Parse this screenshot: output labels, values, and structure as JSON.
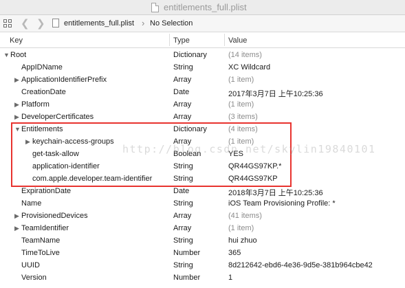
{
  "window": {
    "title": "entitlements_full.plist"
  },
  "jumpbar": {
    "file_name": "entitlements_full.plist",
    "separator": "›",
    "selection": "No Selection"
  },
  "columns": {
    "key": "Key",
    "type": "Type",
    "value": "Value"
  },
  "rows": [
    {
      "key": "Root",
      "type": "Dictionary",
      "value": "(14 items)",
      "level": 0,
      "disclosure": "expanded",
      "muted": true
    },
    {
      "key": "AppIDName",
      "type": "String",
      "value": "XC Wildcard",
      "level": 1,
      "disclosure": "none",
      "muted": false
    },
    {
      "key": "ApplicationIdentifierPrefix",
      "type": "Array",
      "value": "(1 item)",
      "level": 1,
      "disclosure": "collapsed",
      "muted": true
    },
    {
      "key": "CreationDate",
      "type": "Date",
      "value": "2017年3月7日 上午10:25:36",
      "level": 1,
      "disclosure": "none",
      "muted": false
    },
    {
      "key": "Platform",
      "type": "Array",
      "value": "(1 item)",
      "level": 1,
      "disclosure": "collapsed",
      "muted": true
    },
    {
      "key": "DeveloperCertificates",
      "type": "Array",
      "value": "(3 items)",
      "level": 1,
      "disclosure": "collapsed",
      "muted": true
    },
    {
      "key": "Entitlements",
      "type": "Dictionary",
      "value": "(4 items)",
      "level": 1,
      "disclosure": "expanded",
      "muted": true
    },
    {
      "key": "keychain-access-groups",
      "type": "Array",
      "value": "(1 item)",
      "level": 2,
      "disclosure": "collapsed",
      "muted": true
    },
    {
      "key": "get-task-allow",
      "type": "Boolean",
      "value": "YES",
      "level": 2,
      "disclosure": "none",
      "muted": false
    },
    {
      "key": "application-identifier",
      "type": "String",
      "value": "QR44GS97KP.*",
      "level": 2,
      "disclosure": "none",
      "muted": false
    },
    {
      "key": "com.apple.developer.team-identifier",
      "type": "String",
      "value": "QR44GS97KP",
      "level": 2,
      "disclosure": "none",
      "muted": false
    },
    {
      "key": "ExpirationDate",
      "type": "Date",
      "value": "2018年3月7日 上午10:25:36",
      "level": 1,
      "disclosure": "none",
      "muted": false
    },
    {
      "key": "Name",
      "type": "String",
      "value": "iOS Team Provisioning Profile: *",
      "level": 1,
      "disclosure": "none",
      "muted": false
    },
    {
      "key": "ProvisionedDevices",
      "type": "Array",
      "value": "(41 items)",
      "level": 1,
      "disclosure": "collapsed",
      "muted": true
    },
    {
      "key": "TeamIdentifier",
      "type": "Array",
      "value": "(1 item)",
      "level": 1,
      "disclosure": "collapsed",
      "muted": true
    },
    {
      "key": "TeamName",
      "type": "String",
      "value": "hui zhuo",
      "level": 1,
      "disclosure": "none",
      "muted": false
    },
    {
      "key": "TimeToLive",
      "type": "Number",
      "value": "365",
      "level": 1,
      "disclosure": "none",
      "muted": false
    },
    {
      "key": "UUID",
      "type": "String",
      "value": "8d212642-ebd6-4e36-9d5e-381b964cbe42",
      "level": 1,
      "disclosure": "none",
      "muted": false
    },
    {
      "key": "Version",
      "type": "Number",
      "value": "1",
      "level": 1,
      "disclosure": "none",
      "muted": false
    }
  ],
  "watermark": "http://blog.csdn.net/skylin19840101",
  "colors": {
    "highlight_border": "#e8322e",
    "muted_text": "#8b8b8b"
  }
}
